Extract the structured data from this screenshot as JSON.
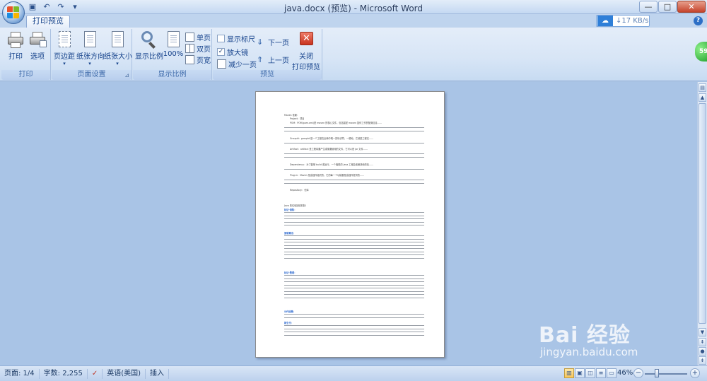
{
  "window": {
    "title": "java.docx (预览) - Microsoft Word",
    "controls": [
      "—",
      "□",
      "✕"
    ]
  },
  "qat": {
    "save": "▣",
    "undo": "↶",
    "redo": "↷",
    "more": "▾"
  },
  "tabs": {
    "active": "打印预览"
  },
  "speed": {
    "text": "↓17 KB/s"
  },
  "ribbon": {
    "print_group": {
      "label": "打印",
      "print": "打印",
      "options": "选项"
    },
    "page_setup_group": {
      "label": "页面设置",
      "margins": "页边距",
      "orientation": "纸张方向",
      "size": "纸张大小"
    },
    "zoom_group": {
      "label": "显示比例",
      "zoom": "显示比例",
      "hundred": "100%",
      "one_page": "单页",
      "two_pages": "双页",
      "page_width": "页宽"
    },
    "preview_group": {
      "label": "预览",
      "show_ruler": "显示标尺",
      "magnifier": "放大镜",
      "shrink": "减少一页",
      "next": "下一页",
      "prev": "上一页",
      "close": "关闭\n打印预览",
      "close_line1": "关闭",
      "close_line2": "打印预览"
    }
  },
  "document": {
    "heading1": "Maven 依赖：",
    "heading2": "Java 的垃圾回收机制：",
    "lines": [
      "Project：项目",
      "POM：POM(pom.xml)是 maven 的核心文件，包括描述 maven 如何工作的配置信息……",
      "Groupld：groupId 是一个工程在全局中唯一的标识符，一般地，它就是工程名……",
      "Artifact：artifact 是工程将要产生或需要使用的文件，它可以是 jar 文件……",
      "Dependency：为了能够 build 或运行，一个典型的 java 工程会依赖其他的包……",
      "Plug-in：Maven 是由插件组织的，它的每一个功能都是由插件提供的……",
      "Repository：仓库"
    ],
    "para_labels": [
      "标记-清除：",
      "复制算法：",
      "标记-整理：",
      "分代收集：",
      "新生代："
    ]
  },
  "status": {
    "page": "页面: 1/4",
    "words": "字数: 2,255",
    "lang": "英语(美国)",
    "insert": "插入",
    "zoom": "46%"
  },
  "watermark": {
    "main": "Bai 经验",
    "sub": "jingyan.baidu.com"
  },
  "badge": {
    "text": "59"
  }
}
